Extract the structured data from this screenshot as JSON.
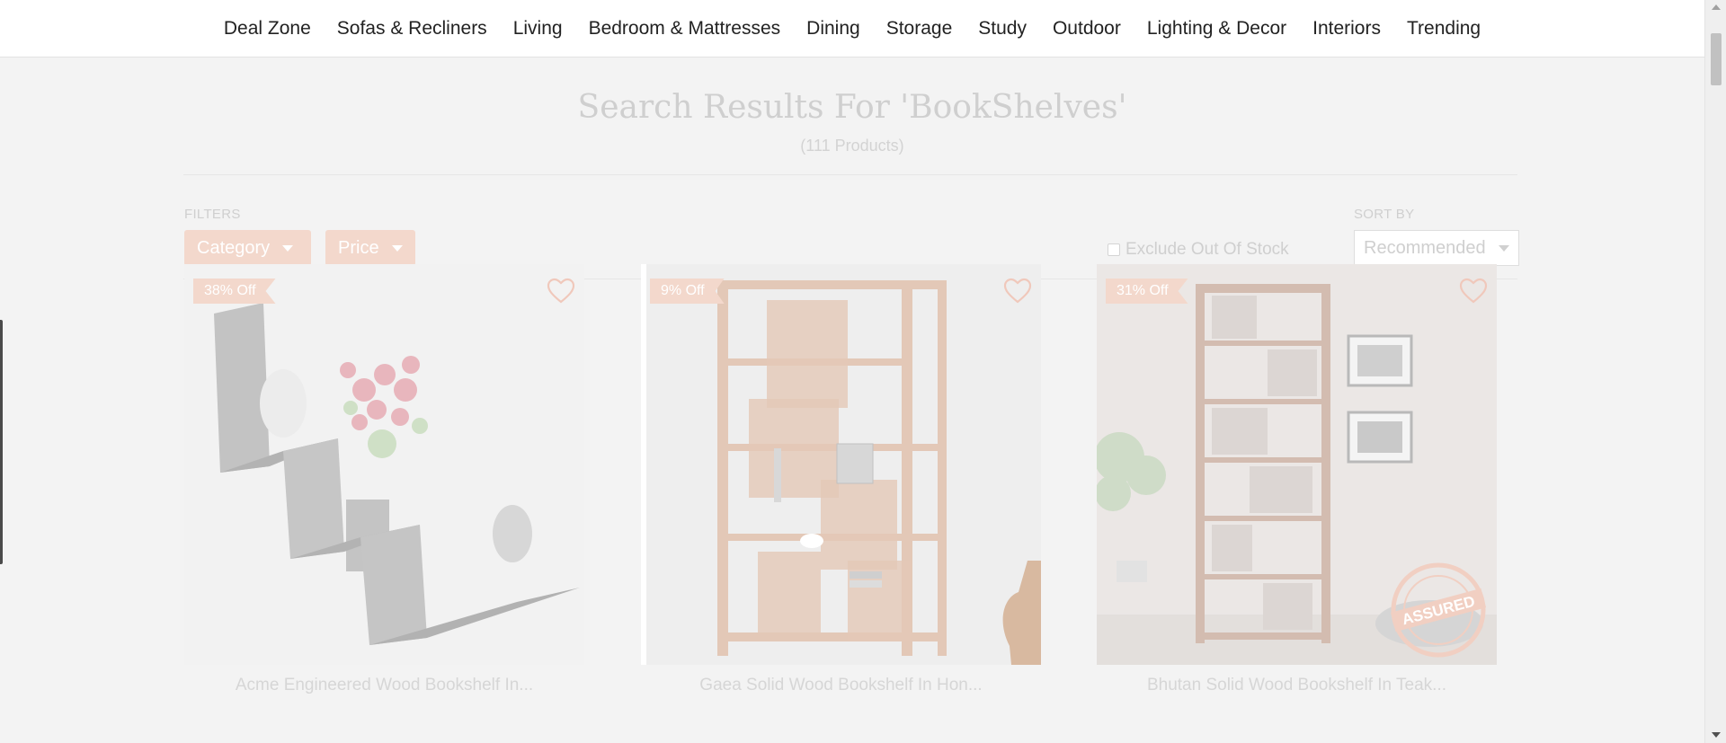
{
  "nav": {
    "items": [
      {
        "label": "Deal Zone"
      },
      {
        "label": "Sofas & Recliners"
      },
      {
        "label": "Living"
      },
      {
        "label": "Bedroom & Mattresses"
      },
      {
        "label": "Dining"
      },
      {
        "label": "Storage"
      },
      {
        "label": "Study"
      },
      {
        "label": "Outdoor"
      },
      {
        "label": "Lighting & Decor"
      },
      {
        "label": "Interiors"
      },
      {
        "label": "Trending"
      }
    ]
  },
  "search": {
    "title": "Search Results For 'BookShelves'",
    "count": "(111 Products)"
  },
  "filters": {
    "label": "FILTERS",
    "category_label": "Category",
    "price_label": "Price",
    "exclude_out_of_stock_label": "Exclude Out Of Stock",
    "exclude_out_of_stock_checked": false
  },
  "sort": {
    "label": "SORT BY",
    "selected": "Recommended"
  },
  "products": [
    {
      "badge": "38% Off",
      "title": "Acme Engineered Wood Bookshelf In...",
      "wishlisted": false,
      "image_icon": "wall-shelf-image"
    },
    {
      "badge": "9% Off",
      "title": "Gaea Solid Wood Bookshelf In Hon...",
      "wishlisted": false,
      "image_icon": "bookshelf-image"
    },
    {
      "badge": "31% Off",
      "title": "Bhutan Solid Wood Bookshelf In Teak...",
      "wishlisted": false,
      "image_icon": "bookshelf-image",
      "assured_stamp": "ASSURED"
    }
  ],
  "colors": {
    "badge_bg": "#f3d8cc",
    "overlay_text": "#cfcfcf",
    "nav_text": "#222222"
  }
}
